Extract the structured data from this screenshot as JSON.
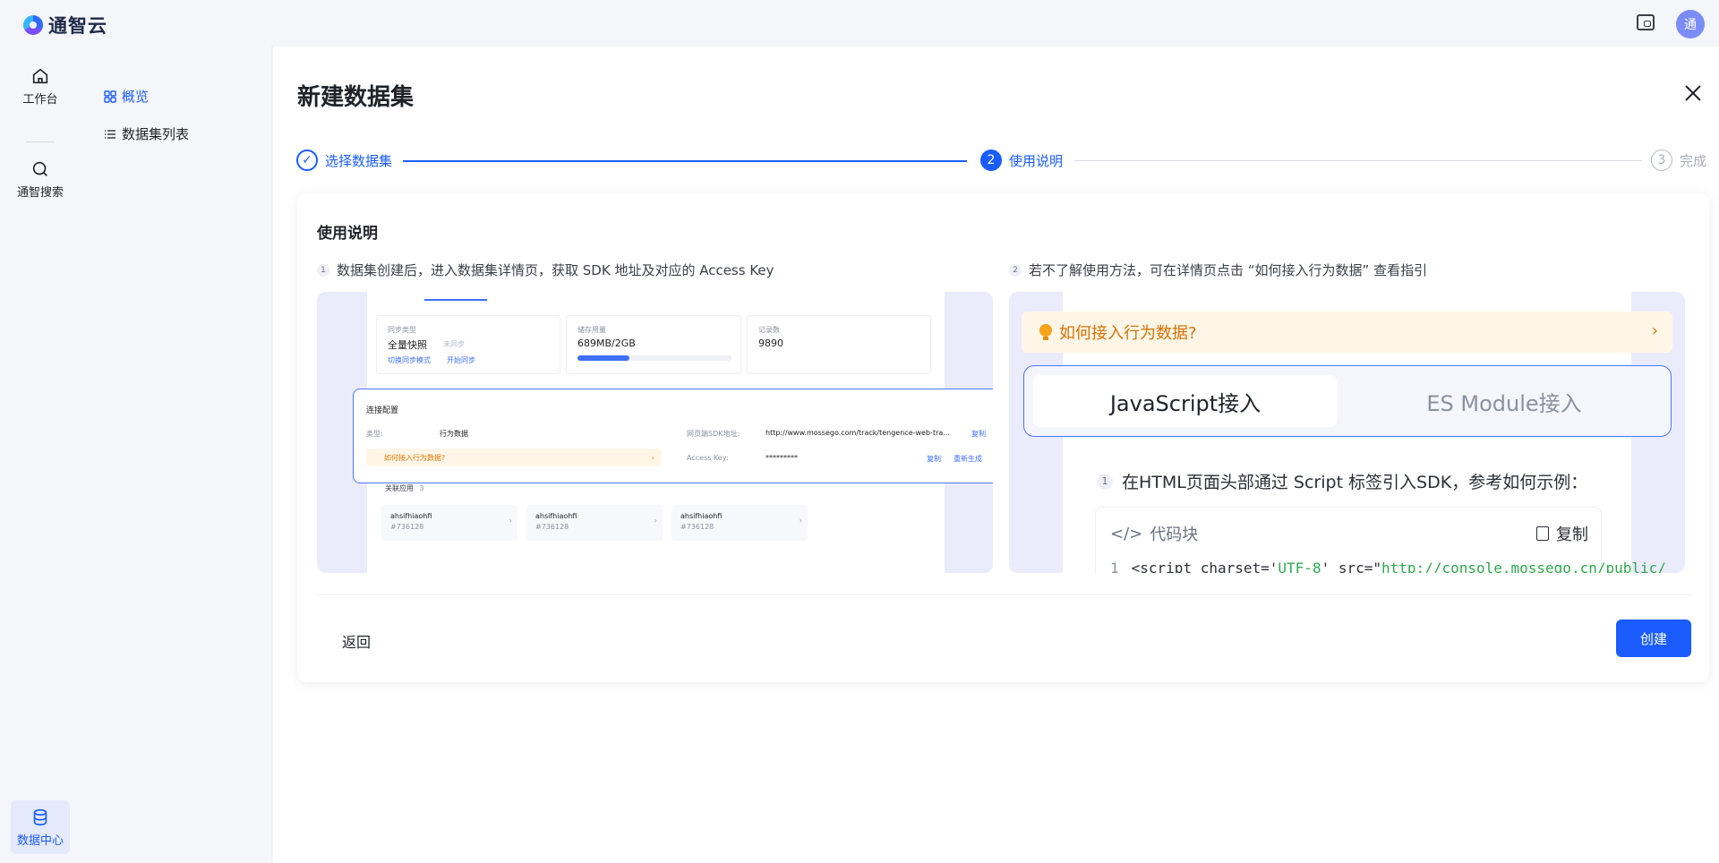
{
  "app": {
    "name": "通智云",
    "avatar_text": "通"
  },
  "rail": {
    "items": [
      {
        "label": "工作台",
        "icon": "home-icon"
      },
      {
        "label": "通智搜索",
        "icon": "search-icon"
      }
    ],
    "bottom": {
      "label": "数据中心",
      "icon": "database-icon"
    }
  },
  "subnav": {
    "items": [
      {
        "label": "概览",
        "icon": "grid-icon",
        "active": true
      },
      {
        "label": "数据集列表",
        "icon": "list-icon",
        "active": false
      }
    ]
  },
  "page": {
    "title": "新建数据集"
  },
  "steps": [
    {
      "label": "选择数据集",
      "marker": "✓",
      "state": "done"
    },
    {
      "label": "使用说明",
      "marker": "2",
      "state": "current"
    },
    {
      "label": "完成",
      "marker": "3",
      "state": "pending"
    }
  ],
  "card": {
    "title": "使用说明",
    "tips": [
      {
        "num": "1",
        "text": "数据集创建后，进入数据集详情页，获取 SDK 地址及对应的 Access Key"
      },
      {
        "num": "2",
        "text": "若不了解使用方法，可在详情页点击 “如何接入行为数据” 查看指引"
      }
    ],
    "preview_left": {
      "sync_type_label": "同步类型",
      "sync_type_value": "全量快照",
      "sync_status": "未同步",
      "switch_mode": "切换同步模式",
      "start_sync": "开始同步",
      "storage_label": "储存用量",
      "storage_value": "689MB/2GB",
      "storage_fraction": 0.34,
      "records_label": "记录数",
      "records_value": "9890",
      "connect_title": "连接配置",
      "type_label": "类型:",
      "type_value": "行为数据",
      "sdk_label": "网页端SDK地址:",
      "sdk_value": "http://www.mossego.com/track/tengence-web-tra...",
      "copy": "复制",
      "access_key_label": "Access Key:",
      "access_key_value": "*********",
      "regenerate": "重新生成",
      "howto": "如何接入行为数据?",
      "apps_title": "关联应用",
      "apps_count": "3",
      "apps": [
        {
          "name": "ahsifhiaohfi",
          "id": "#736128"
        },
        {
          "name": "ahsifhiaohfi",
          "id": "#736128"
        },
        {
          "name": "ahsifhiaohfi",
          "id": "#736128"
        }
      ]
    },
    "preview_right": {
      "banner": "如何接入行为数据?",
      "tab_active": "JavaScript接入",
      "tab_inactive": "ES Module接入",
      "step_num": "1",
      "step_text": "在HTML页面头部通过 Script 标签引入SDK，参考如何示例：",
      "code_title": "代码块",
      "copy": "复制",
      "code_line_num": "1",
      "code_prefix": "<script charset='",
      "code_charset": "UTF-8",
      "code_mid": "' src=\"",
      "code_src": "http://console.mossego.cn/public/"
    },
    "back": "返回",
    "create": "创建"
  },
  "colors": {
    "primary": "#1a5cff",
    "warning": "#d67200",
    "code_string": "#2fa84f"
  }
}
